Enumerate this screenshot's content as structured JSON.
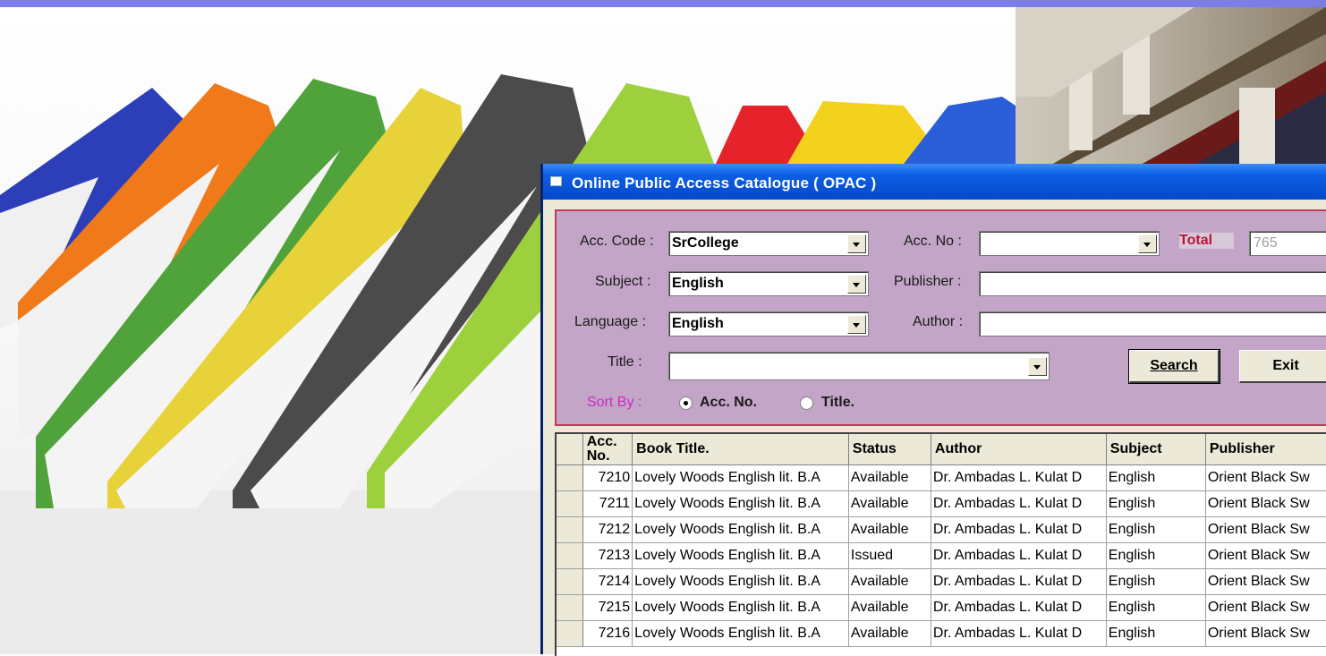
{
  "window": {
    "title": "Online Public Access Catalogue ( OPAC )"
  },
  "form": {
    "acc_code_label": "Acc. Code :",
    "acc_code_value": "SrCollege",
    "acc_no_label": "Acc. No :",
    "acc_no_value": "",
    "total_label": "Total",
    "total_value": "765",
    "subject_label": "Subject :",
    "subject_value": "English",
    "publisher_label": "Publisher :",
    "publisher_value": "",
    "language_label": "Language :",
    "language_value": "English",
    "author_label": "Author :",
    "author_value": "",
    "title_label": "Title :",
    "title_value": "",
    "search_label": "Search",
    "exit_label": "Exit",
    "sort_by_label": "Sort By :",
    "sort_acc_no": "Acc. No.",
    "sort_title": "Title.",
    "sort_selected": "Acc. No."
  },
  "grid": {
    "headers": [
      "Acc. No.",
      "Book Title.",
      "Status",
      "Author",
      "Subject",
      "Publisher"
    ],
    "rows": [
      [
        "7210",
        "Lovely Woods English lit. B.A",
        "Available",
        "Dr. Ambadas L. Kulat D",
        "English",
        "Orient Black Sw"
      ],
      [
        "7211",
        "Lovely Woods English lit. B.A",
        "Available",
        "Dr. Ambadas L. Kulat D",
        "English",
        "Orient Black Sw"
      ],
      [
        "7212",
        "Lovely Woods English lit. B.A",
        "Available",
        "Dr. Ambadas L. Kulat D",
        "English",
        "Orient Black Sw"
      ],
      [
        "7213",
        "Lovely Woods English lit. B.A",
        "Issued",
        "Dr. Ambadas L. Kulat D",
        "English",
        "Orient Black Sw"
      ],
      [
        "7214",
        "Lovely Woods English lit. B.A",
        "Available",
        "Dr. Ambadas L. Kulat D",
        "English",
        "Orient Black Sw"
      ],
      [
        "7215",
        "Lovely Woods English lit. B.A",
        "Available",
        "Dr. Ambadas L. Kulat D",
        "English",
        "Orient Black Sw"
      ],
      [
        "7216",
        "Lovely Woods English lit. B.A",
        "Available",
        "Dr. Ambadas L. Kulat D",
        "English",
        "Orient Black Sw"
      ]
    ]
  }
}
